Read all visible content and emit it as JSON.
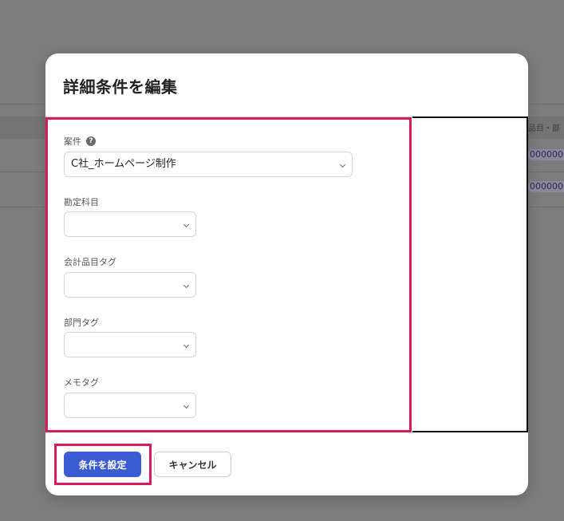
{
  "background": {
    "column_header": "品目・部",
    "row_values": [
      "0000000",
      "0000000"
    ]
  },
  "modal": {
    "title": "詳細条件を編集",
    "fields": [
      {
        "label": "案件",
        "has_help": true,
        "value": "C社_ホームページ制作"
      },
      {
        "label": "勘定科目",
        "value": ""
      },
      {
        "label": "会計品目タグ",
        "value": ""
      },
      {
        "label": "部門タグ",
        "value": ""
      },
      {
        "label": "メモタグ",
        "value": ""
      }
    ],
    "help_icon_glyph": "?",
    "buttons": {
      "submit": "条件を設定",
      "cancel": "キャンセル"
    }
  },
  "colors": {
    "primary": "#3b5bd3",
    "highlight": "#d81b60",
    "overlay": "#7c7c7c"
  }
}
